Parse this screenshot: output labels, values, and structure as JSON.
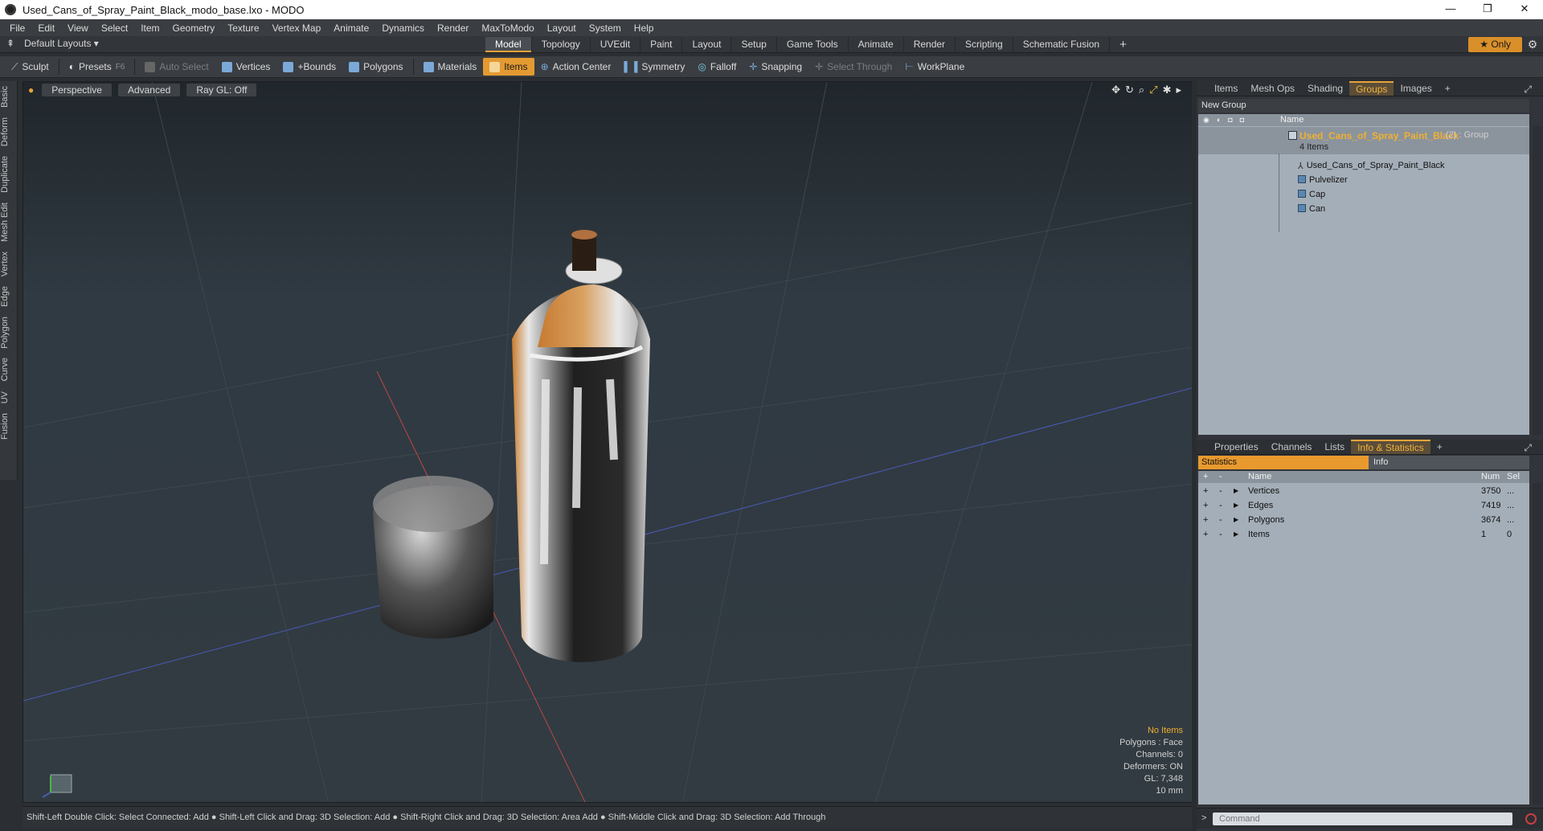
{
  "window": {
    "title": "Used_Cans_of_Spray_Paint_Black_modo_base.lxo - MODO",
    "buttons": {
      "minimize": "—",
      "maximize": "❐",
      "close": "✕"
    }
  },
  "menubar": [
    "File",
    "Edit",
    "View",
    "Select",
    "Item",
    "Geometry",
    "Texture",
    "Vertex Map",
    "Animate",
    "Dynamics",
    "Render",
    "MaxToModo",
    "Layout",
    "System",
    "Help"
  ],
  "layout": {
    "menu_label": "Default Layouts ▾",
    "tabs": [
      "Model",
      "Topology",
      "UVEdit",
      "Paint",
      "Layout",
      "Setup",
      "Game Tools",
      "Animate",
      "Render",
      "Scripting",
      "Schematic Fusion"
    ],
    "active_tab": "Model",
    "plus": "+",
    "only_label": "★  Only",
    "gear": "⚙"
  },
  "toolbar": {
    "sculpt": "Sculpt",
    "presets": "Presets",
    "presets_key": "F6",
    "auto_select": "Auto Select",
    "vertices": "Vertices",
    "bounds": "+Bounds",
    "polygons": "Polygons",
    "materials": "Materials",
    "items": "Items",
    "action_center": "Action Center",
    "symmetry": "Symmetry",
    "falloff": "Falloff",
    "snapping": "Snapping",
    "select_through": "Select Through",
    "workplane": "WorkPlane"
  },
  "left_tabs": [
    "Basic",
    "Deform",
    "Duplicate",
    "Mesh Edit",
    "Vertex",
    "Edge",
    "Polygon",
    "Curve",
    "UV",
    "Fusion"
  ],
  "viewport": {
    "perspective": "Perspective",
    "advanced": "Advanced",
    "raygl": "Ray GL: Off",
    "info": {
      "selection": "No Items",
      "polygons": "Polygons : Face",
      "channels": "Channels: 0",
      "deformers": "Deformers: ON",
      "gl": "GL: 7,348",
      "scale": "10 mm"
    }
  },
  "statusbar": "Shift-Left Double Click: Select Connected: Add ● Shift-Left Click and Drag: 3D Selection: Add ● Shift-Right Click and Drag: 3D Selection: Area Add ● Shift-Middle Click and Drag: 3D Selection: Add Through",
  "groups_panel": {
    "tabs": [
      "Items",
      "Mesh Ops",
      "Shading",
      "Groups",
      "Images"
    ],
    "active_tab": "Groups",
    "plus": "+",
    "new_group": "New Group",
    "name_header": "Name",
    "group": {
      "name": "Used_Cans_of_Spray_Paint_Black",
      "count": "(2) : Group",
      "sub": "4 Items"
    },
    "items": [
      "Used_Cans_of_Spray_Paint_Black",
      "Pulvelizer",
      "Cap",
      "Can"
    ]
  },
  "stats_panel": {
    "tabs": [
      "Properties",
      "Channels",
      "Lists",
      "Info & Statistics"
    ],
    "active_tab": "Info & Statistics",
    "plus": "+",
    "sub_tabs": {
      "statistics": "Statistics",
      "info": "Info"
    },
    "headers": {
      "name": "Name",
      "num": "Num",
      "sel": "Sel"
    },
    "rows": [
      {
        "name": "Vertices",
        "num": "3750",
        "sel": "..."
      },
      {
        "name": "Edges",
        "num": "7419",
        "sel": "..."
      },
      {
        "name": "Polygons",
        "num": "3674",
        "sel": "..."
      },
      {
        "name": "Items",
        "num": "1",
        "sel": "0"
      }
    ]
  },
  "command": {
    "prompt": ">",
    "placeholder": "Command"
  }
}
